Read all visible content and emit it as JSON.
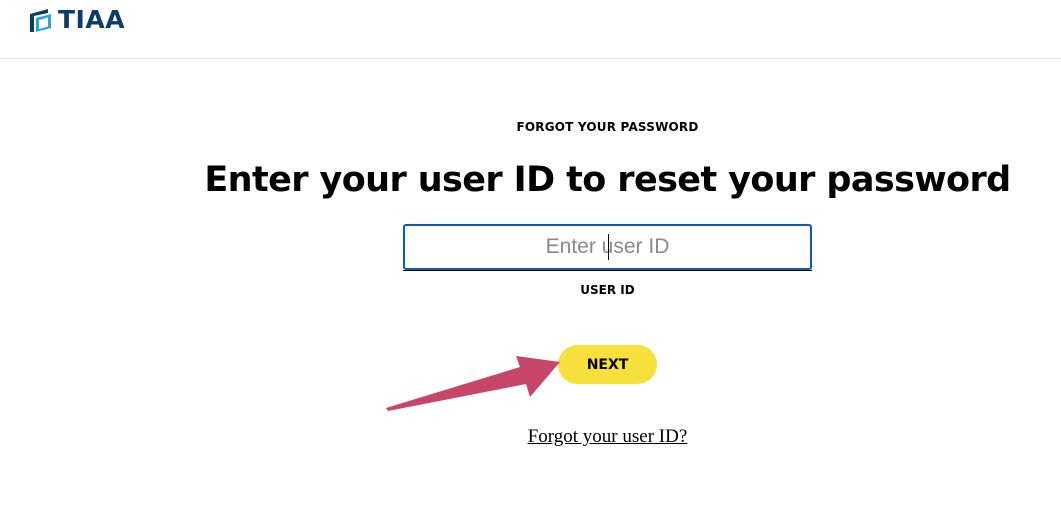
{
  "header": {
    "logo_text": "TIAA",
    "brand_color": "#0b3d66"
  },
  "main": {
    "eyebrow": "FORGOT YOUR PASSWORD",
    "headline": "Enter your user ID to reset your password",
    "user_id_input": {
      "placeholder": "Enter user ID",
      "value": "",
      "label": "USER ID",
      "border_color": "#0b5cad"
    },
    "next_button": {
      "label": "NEXT",
      "color": "#f7e03c"
    },
    "forgot_user_id_link": "Forgot your user ID?"
  },
  "annotation": {
    "icon": "arrow-icon",
    "color": "#c8456a"
  }
}
